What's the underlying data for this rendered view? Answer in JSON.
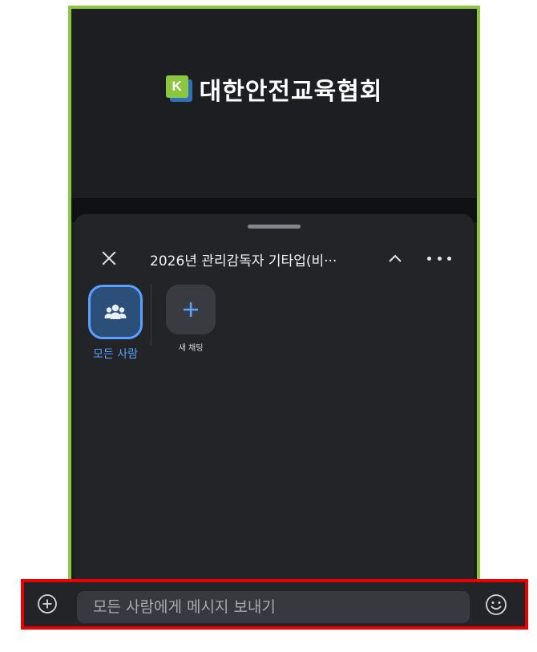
{
  "presentation": {
    "logo_letter": "K",
    "organization_name": "대한안전교육협회"
  },
  "chat_sheet": {
    "title": "2026년 관리감독자 기타업(비···",
    "icons": {
      "close": "close-icon",
      "collapse": "chevron-up-icon",
      "more": "more-horizontal-icon"
    },
    "recipients": [
      {
        "label": "모든 사람",
        "icon": "group-icon",
        "selected": true
      },
      {
        "label": "새 채팅",
        "icon": "plus-icon",
        "selected": false
      }
    ]
  },
  "composer": {
    "placeholder": "모든 사람에게 메시지 보내기",
    "value": "",
    "icons": {
      "add": "plus-circle-icon",
      "emoji": "smiley-icon"
    }
  },
  "colors": {
    "highlight_green": "#8cc63f",
    "highlight_red": "#ee0000",
    "accent_blue": "#5aa0ff",
    "sheet_bg": "#232427"
  }
}
